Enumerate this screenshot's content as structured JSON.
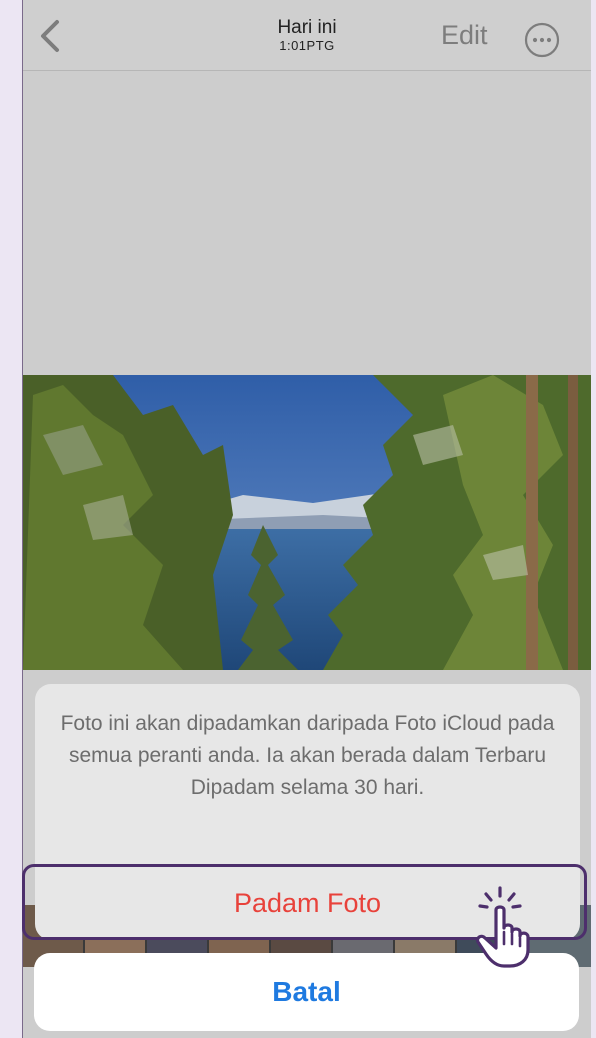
{
  "navbar": {
    "title": "Hari ini",
    "subtitle": "1:01PTG",
    "edit_label": "Edit",
    "back_icon": "chevron-left-icon",
    "more_icon": "ellipsis-circle-icon"
  },
  "sheet": {
    "message": "Foto ini akan dipadamkan daripada Foto iCloud pada semua peranti anda. Ia akan berada dalam Terbaru Dipadam selama 30 hari.",
    "delete_label": "Padam Foto",
    "cancel_label": "Batal"
  },
  "colors": {
    "destructive": "#e8423b",
    "accent": "#1f7ae0",
    "highlight": "#4d2f6c"
  },
  "overlay": {
    "pointer_icon": "tap-hand-icon"
  }
}
